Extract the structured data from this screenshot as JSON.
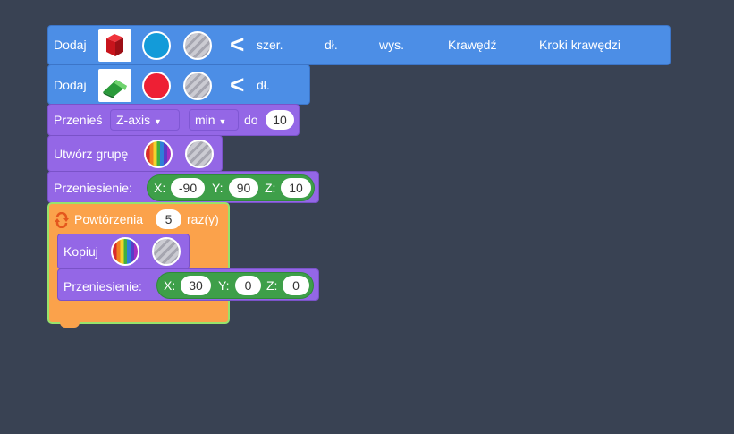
{
  "block1": {
    "label": "Dodaj",
    "shape_icon": "red-cube-icon",
    "color": "#139bd9",
    "texture_icon": "stripe-texture-icon",
    "chevron": "<",
    "params": [
      "szer.",
      "dł.",
      "wys.",
      "Krawędź",
      "Kroki krawędzi"
    ]
  },
  "block2": {
    "label": "Dodaj",
    "shape_icon": "green-prism-icon",
    "color": "#ee1f34",
    "texture_icon": "stripe-texture-icon",
    "chevron": "<",
    "params": [
      "dł."
    ]
  },
  "block3": {
    "label": "Przenieś",
    "axis": "Z-axis",
    "mode": "min",
    "to_label": "do",
    "value": "10"
  },
  "block4": {
    "label": "Utwórz grupę",
    "color_icon": "rainbow-color-icon",
    "texture_icon": "stripe-texture-icon"
  },
  "block5": {
    "label": "Przeniesienie:",
    "x_label": "X:",
    "x": "-90",
    "y_label": "Y:",
    "y": "90",
    "z_label": "Z:",
    "z": "10"
  },
  "repeat": {
    "label": "Powtórzenia",
    "count": "5",
    "suffix": "raz(y)",
    "icon": "repeat-icon"
  },
  "block6": {
    "label": "Kopiuj",
    "color_icon": "rainbow-color-icon",
    "texture_icon": "stripe-texture-icon"
  },
  "block7": {
    "label": "Przeniesienie:",
    "x_label": "X:",
    "x": "30",
    "y_label": "Y:",
    "y": "0",
    "z_label": "Z:",
    "z": "0"
  }
}
